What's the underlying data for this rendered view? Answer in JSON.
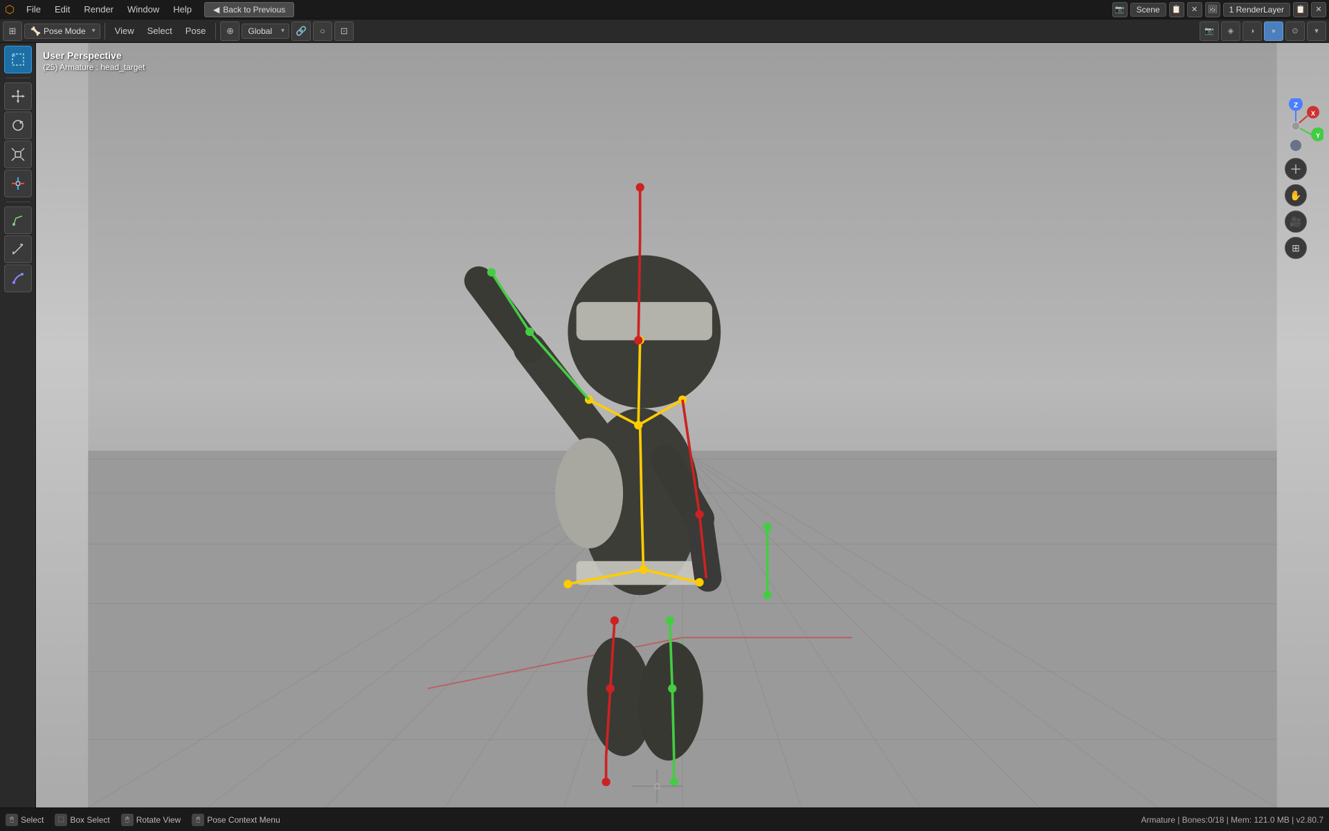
{
  "top_menu": {
    "logo": "⬡",
    "items": [
      "File",
      "Edit",
      "Render",
      "Window",
      "Help"
    ],
    "back_btn": "Back to Previous",
    "scene_icon": "📷",
    "scene_name": "Scene",
    "render_layer": "1 RenderLayer"
  },
  "header_toolbar": {
    "mode": "Pose Mode",
    "nav_items": [
      "View",
      "Select",
      "Pose"
    ],
    "global": "Global"
  },
  "viewport": {
    "perspective": "User Perspective",
    "armature": "(25) Armature : head_target"
  },
  "left_toolbar": {
    "tools": [
      {
        "name": "select-box",
        "icon": "⬚",
        "active": true
      },
      {
        "name": "move",
        "icon": "✛"
      },
      {
        "name": "rotate",
        "icon": "↻"
      },
      {
        "name": "scale",
        "icon": "⤡"
      },
      {
        "name": "transform",
        "icon": "⊕"
      },
      {
        "name": "annotate",
        "icon": "✏"
      },
      {
        "name": "measure",
        "icon": "📐"
      },
      {
        "name": "grease-pencil",
        "icon": "✒"
      }
    ]
  },
  "status_bar": {
    "select_label": "Select",
    "box_select_label": "Box Select",
    "rotate_view_label": "Rotate View",
    "pose_context_label": "Pose Context Menu",
    "info": "Armature | Bones:0/18 | Mem: 121.0 MB | v2.80.7"
  }
}
